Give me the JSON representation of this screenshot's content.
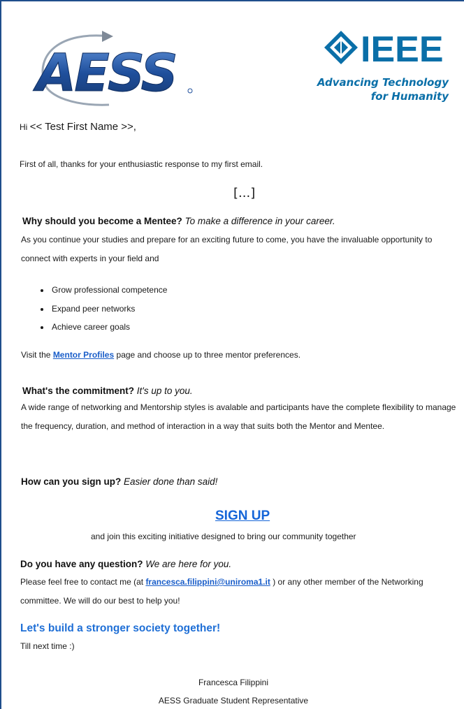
{
  "header": {
    "aess_logo_text": "AESS",
    "ieee_logo_text": "IEEE",
    "ieee_tagline_1": "Advancing Technology",
    "ieee_tagline_2": "for Humanity"
  },
  "greeting": {
    "hi": "Hi",
    "name": "<< Test First Name >>,"
  },
  "intro": "First of all, thanks for your enthusiastic response to my first email.",
  "ellipsis": "[...]",
  "mentee": {
    "heading": "Why should you become a Mentee?",
    "tagline": "To make a difference in your career.",
    "body": "As you continue your studies and prepare for an exciting future to come, you have the invaluable opportunity to connect with experts in your field and",
    "bullets": [
      "Grow professional competence",
      "Expand peer networks",
      "Achieve career goals"
    ],
    "visit_prefix": "Visit the",
    "visit_link": "Mentor Profiles",
    "visit_suffix": "page and choose up to three mentor preferences."
  },
  "commitment": {
    "heading": "What's the commitment?",
    "tagline": "It's up to you.",
    "body": "A wide range of networking and Mentorship styles is avalable and participants have the complete flexibility to manage the frequency, duration, and method of interaction in a way that suits both the Mentor and Mentee."
  },
  "signup": {
    "heading": "How can you sign up?",
    "tagline": "Easier done than said!",
    "button": "SIGN UP",
    "subtext": "and join this exciting initiative designed to bring our community together"
  },
  "question": {
    "heading": "Do you have any question?",
    "tagline": "We are here for you.",
    "body_prefix": "Please feel free to contact me (at",
    "email": "francesca.filippini@uniroma1.it",
    "body_suffix": ") or any other member of the Networking committee. We will do our best to help you!"
  },
  "closing": {
    "slogan": "Let's build a stronger society together!",
    "till": "Till next time :)",
    "signature_name": "Francesca Filippini",
    "signature_title": "AESS Graduate Student Representative"
  },
  "colors": {
    "aess_blue": "#1f4f9c",
    "ieee_blue": "#0a6fa8",
    "link_blue": "#1a5ec9",
    "border_blue": "#1f4e8c"
  }
}
